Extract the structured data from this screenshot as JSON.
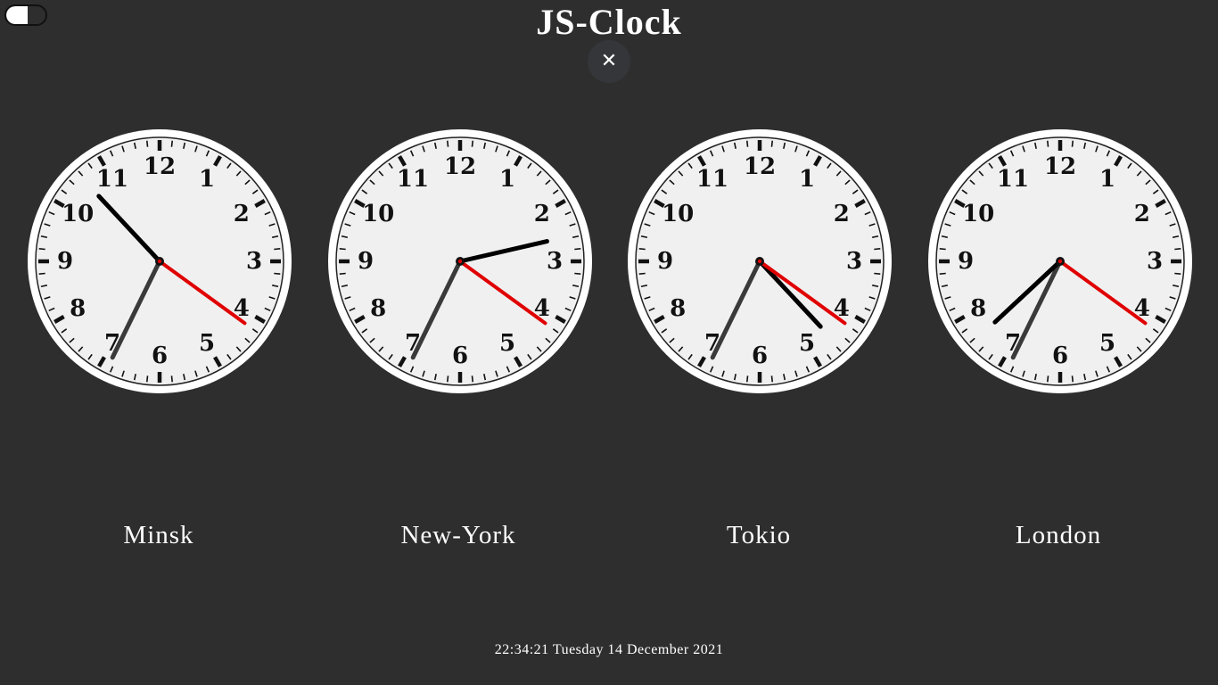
{
  "header": {
    "title": "JS-Clock",
    "close_label": "✕"
  },
  "theme_toggle": {
    "icon": "toggle-switch-icon"
  },
  "colors": {
    "background": "#2e2e2e",
    "face": "#f0f0f0",
    "hour_hand": "#000000",
    "minute_hand": "#3a3a3a",
    "second_hand": "#e00000"
  },
  "clocks": [
    {
      "city": "Minsk",
      "hours": 22,
      "minutes": 34,
      "seconds": 21
    },
    {
      "city": "New-York",
      "hours": 14,
      "minutes": 34,
      "seconds": 21
    },
    {
      "city": "Tokio",
      "hours": 4,
      "minutes": 34,
      "seconds": 21
    },
    {
      "city": "London",
      "hours": 19,
      "minutes": 34,
      "seconds": 21
    }
  ],
  "clock_face": {
    "numerals": [
      "12",
      "1",
      "2",
      "3",
      "4",
      "5",
      "6",
      "7",
      "8",
      "9",
      "10",
      "11"
    ]
  },
  "footer": {
    "datetime": "22:34:21 Tuesday 14 December 2021"
  }
}
